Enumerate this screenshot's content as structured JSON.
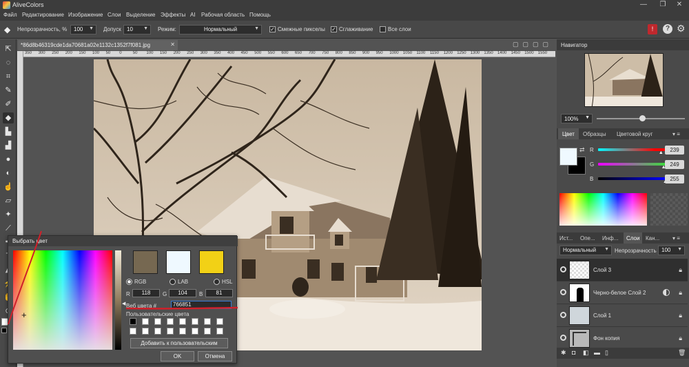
{
  "app": {
    "title": "AliveColors"
  },
  "menu": [
    "Файл",
    "Редактирование",
    "Изображение",
    "Слои",
    "Выделение",
    "Эффекты",
    "AI",
    "Рабочая область",
    "Помощь"
  ],
  "options": {
    "opacity_label": "Непрозрачность, %",
    "opacity_value": "100",
    "tolerance_label": "Допуск",
    "tolerance_value": "10",
    "mode_label": "Режим:",
    "mode_value": "Нормальный",
    "contiguous_label": "Смежные пикселы",
    "antialias_label": "Сглаживание",
    "all_layers_label": "Все слои",
    "contiguous_checked": true,
    "antialias_checked": true,
    "all_layers_checked": false
  },
  "document": {
    "tab_title": "*86d8b46319cde1da70681a02e1132c1352f7f081.jpg",
    "ruler_ticks": [
      "350",
      "300",
      "250",
      "200",
      "150",
      "100",
      "50",
      "0",
      "50",
      "100",
      "150",
      "200",
      "250",
      "300",
      "350",
      "400",
      "450",
      "500",
      "550",
      "600",
      "650",
      "700",
      "750",
      "800",
      "850",
      "900",
      "950",
      "1000",
      "1050",
      "1100",
      "1150",
      "1200",
      "1250",
      "1300",
      "1350",
      "1400",
      "1450",
      "1500",
      "1550"
    ]
  },
  "navigator": {
    "title": "Навигатор",
    "zoom": "100%"
  },
  "color_panel": {
    "tabs": [
      "Цвет",
      "Образцы",
      "Цветовой круг"
    ],
    "r_label": "R",
    "g_label": "G",
    "b_label": "B",
    "r": "239",
    "g": "249",
    "b": "255",
    "r_level": 0.937,
    "g_level": 0.976,
    "b_level": 1.0,
    "foreground": "#eff9ff",
    "background": "#000000"
  },
  "layers_panel": {
    "tabs": [
      "Ист...",
      "Опе...",
      "Инф...",
      "Слои",
      "Кан..."
    ],
    "blend_mode": "Нормальный",
    "opacity_label": "Непрозрачность",
    "opacity_value": "100",
    "layers": [
      {
        "name": "Слой 3"
      },
      {
        "name": "Черно-белое Слой 2"
      },
      {
        "name": "Слой 1"
      },
      {
        "name": "Фон копия"
      }
    ]
  },
  "color_dialog": {
    "title": "Выбрать цвет",
    "swatch_new": "#766851",
    "swatch_old": "#eff9ff",
    "swatch_third": "#f2d116",
    "models": [
      "RGB",
      "LAB",
      "HSL"
    ],
    "selected_model": "RGB",
    "r_label": "R",
    "g_label": "G",
    "b_label": "B",
    "r": "118",
    "g": "104",
    "b": "81",
    "web_label": "Веб цвета #",
    "web_value": "766851",
    "custom_label": "Пользовательские цвета",
    "add_button": "Добавить к пользовательским",
    "ok_button": "OK",
    "cancel_button": "Отмена"
  },
  "colors": {
    "accent": "#e0a400",
    "annotation_red": "#d0202a",
    "sepia_dark": "#3a2e22",
    "sepia_light": "#d9cbb7"
  }
}
